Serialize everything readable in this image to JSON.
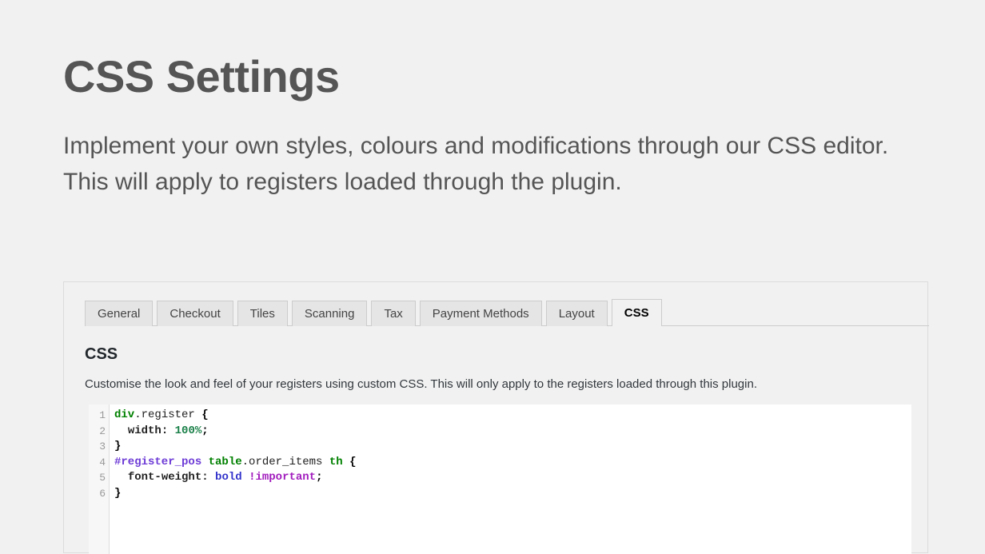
{
  "page": {
    "title": "CSS Settings",
    "subtitle": "Implement your own styles, colours and modifications through our CSS editor. This will apply to registers loaded through the plugin."
  },
  "tabs": [
    {
      "label": "General",
      "active": false
    },
    {
      "label": "Checkout",
      "active": false
    },
    {
      "label": "Tiles",
      "active": false
    },
    {
      "label": "Scanning",
      "active": false
    },
    {
      "label": "Tax",
      "active": false
    },
    {
      "label": "Payment Methods",
      "active": false
    },
    {
      "label": "Layout",
      "active": false
    },
    {
      "label": "CSS",
      "active": true
    }
  ],
  "section": {
    "heading": "CSS",
    "description": "Customise the look and feel of your registers using custom CSS. This will only apply to the registers loaded through this plugin."
  },
  "editor": {
    "line_numbers": [
      "1",
      "2",
      "3",
      "4",
      "5",
      "6"
    ],
    "lines": [
      {
        "num": "1",
        "tokens": [
          {
            "t": "div",
            "c": "tok-tag"
          },
          {
            "t": ".register",
            "c": "tok-plain"
          },
          {
            "t": " ",
            "c": "tok-plain"
          },
          {
            "t": "{",
            "c": "tok-brace"
          }
        ]
      },
      {
        "num": "2",
        "tokens": [
          {
            "t": "  ",
            "c": "tok-plain"
          },
          {
            "t": "width:",
            "c": "tok-prop"
          },
          {
            "t": " ",
            "c": "tok-plain"
          },
          {
            "t": "100%",
            "c": "tok-number"
          },
          {
            "t": ";",
            "c": "tok-brace"
          }
        ]
      },
      {
        "num": "3",
        "tokens": [
          {
            "t": "}",
            "c": "tok-brace"
          }
        ]
      },
      {
        "num": "4",
        "tokens": [
          {
            "t": "#register_pos",
            "c": "tok-id"
          },
          {
            "t": " ",
            "c": "tok-plain"
          },
          {
            "t": "table",
            "c": "tok-tag"
          },
          {
            "t": ".order_items",
            "c": "tok-plain"
          },
          {
            "t": " ",
            "c": "tok-plain"
          },
          {
            "t": "th",
            "c": "tok-tag"
          },
          {
            "t": " ",
            "c": "tok-plain"
          },
          {
            "t": "{",
            "c": "tok-brace"
          }
        ]
      },
      {
        "num": "5",
        "tokens": [
          {
            "t": "  ",
            "c": "tok-plain"
          },
          {
            "t": "font-weight:",
            "c": "tok-prop"
          },
          {
            "t": " ",
            "c": "tok-plain"
          },
          {
            "t": "bold",
            "c": "tok-keyword"
          },
          {
            "t": " ",
            "c": "tok-plain"
          },
          {
            "t": "!important",
            "c": "tok-important"
          },
          {
            "t": ";",
            "c": "tok-brace"
          }
        ]
      },
      {
        "num": "6",
        "tokens": [
          {
            "t": "}",
            "c": "tok-brace"
          }
        ]
      }
    ],
    "plain_text": "div.register {\n  width: 100%;\n}\n#register_pos table.order_items th {\n  font-weight: bold !important;\n}"
  },
  "colors": {
    "page_background": "#f1f1f1",
    "title_text": "#555555",
    "panel_border": "#dcdcdc",
    "tab_background": "#e5e5e5",
    "tab_border": "#cccccc",
    "editor_background": "#ffffff",
    "gutter_text": "#999999",
    "token_tag": "#008000",
    "token_id": "#6d3bd6",
    "token_number": "#1a8049",
    "token_keyword": "#3333cc",
    "token_important": "#a11bbd"
  }
}
